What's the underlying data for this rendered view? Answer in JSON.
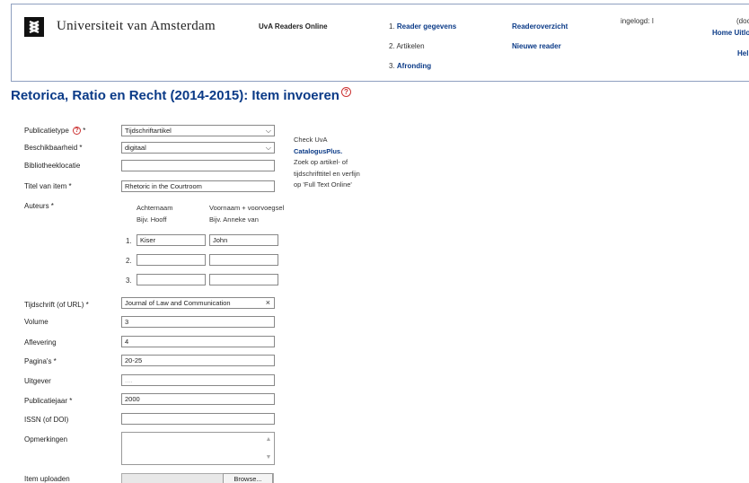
{
  "header": {
    "university": "Universiteit van Amsterdam",
    "product": "UvA Readers Online",
    "steps": [
      {
        "num": "1.",
        "label": "Reader gegevens"
      },
      {
        "num": "2.",
        "label": "Artikelen"
      },
      {
        "num": "3.",
        "label": "Afronding"
      }
    ],
    "links": [
      "Readeroverzicht",
      "Nieuwe reader"
    ],
    "logged_in": "ingelogd: I",
    "role": "(docent",
    "home": "Home",
    "logout": "Uitloggen",
    "help": "Help"
  },
  "title": "Retorica, Ratio en Recht (2014-2015): Item invoeren",
  "form": {
    "publicatietype_label": "Publicatietype",
    "publicatietype_value": "Tijdschriftartikel",
    "beschikbaarheid_label": "Beschikbaarheid *",
    "beschikbaarheid_value": "digitaal",
    "bibliotheek_label": "Bibliotheeklocatie",
    "bibliotheek_value": "",
    "titel_label": "Titel van item *",
    "titel_value": "Rhetoric in the Courtroom",
    "auteurs_label": "Auteurs *",
    "col1_head": "Achternaam",
    "col1_example": "Bijv. Hooff",
    "col2_head": "Voornaam + voorvoegsel",
    "col2_example": "Bijv. Anneke van",
    "authors": [
      {
        "num": "1.",
        "last": "Kiser",
        "first": "John"
      },
      {
        "num": "2.",
        "last": "",
        "first": ""
      },
      {
        "num": "3.",
        "last": "",
        "first": ""
      }
    ],
    "tijdschrift_label": "Tijdschrift (of URL) *",
    "tijdschrift_value": "Journal of Law and Communication",
    "volume_label": "Volume",
    "volume_value": "3",
    "aflevering_label": "Aflevering",
    "aflevering_value": "4",
    "paginas_label": "Pagina's *",
    "paginas_value": "20-25",
    "uitgever_label": "Uitgever",
    "uitgever_placeholder": "....",
    "jaar_label": "Publicatiejaar *",
    "jaar_value": "2000",
    "issn_label": "ISSN (of DOI)",
    "issn_value": "",
    "opmerkingen_label": "Opmerkingen",
    "upload_label": "Item uploaden",
    "browse_label": "Browse..."
  },
  "side_note": {
    "line1": "Check UvA",
    "line2": "CatalogusPlus.",
    "line3": "Zoek op artikel- of",
    "line4": "tijdschrifttitel en verfijn",
    "line5": "op 'Full Text Online'"
  },
  "colors": {
    "brand_blue": "#0a3a87",
    "help_red": "#cc3333"
  }
}
